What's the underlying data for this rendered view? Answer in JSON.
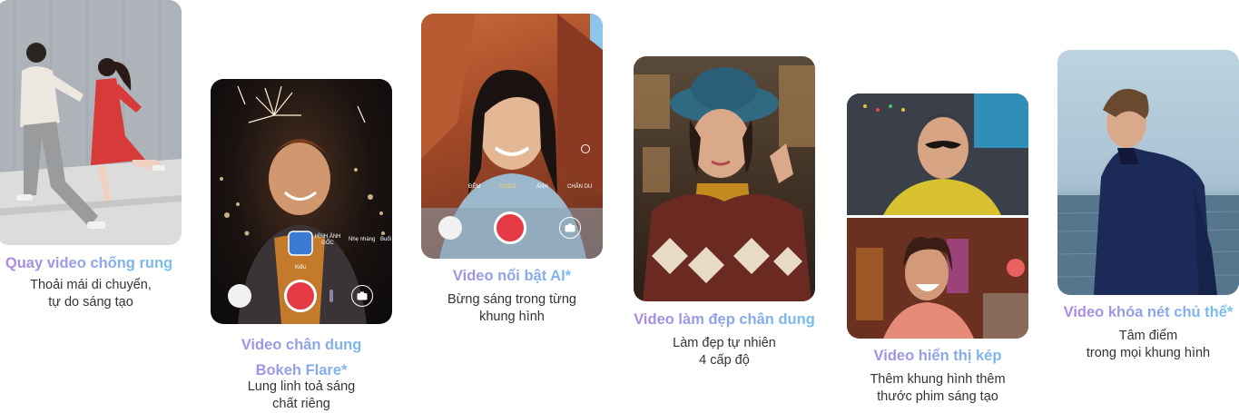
{
  "features": [
    {
      "title": "Quay video chống rung",
      "desc_line1": "Thoải mái di chuyển,",
      "desc_line2": "tự do sáng tạo"
    },
    {
      "title_line1": "Video chân dung",
      "title_line2": "Bokeh Flare*",
      "desc_line1": "Lung linh toả sáng",
      "desc_line2": "chất riêng",
      "camera_ui": {
        "original_label": "HÌNH ẢNH GỐC",
        "soft_label": "Nhẹ nhàng",
        "warm_label": "Buổi",
        "style_label": "Kiểu"
      }
    },
    {
      "title": "Video nổi bật AI*",
      "desc_line1": "Bừng sáng trong từng",
      "desc_line2": "khung hình",
      "camera_ui": {
        "modes": [
          "ĐÊM",
          "VIDEO",
          "ẢNH",
          "CHÂN DU"
        ],
        "active_mode": "VIDEO"
      }
    },
    {
      "title": "Video làm đẹp chân dung",
      "desc_line1": "Làm đẹp tự nhiên",
      "desc_line2": "4 cấp độ"
    },
    {
      "title": "Video hiển thị kép",
      "desc_line1": "Thêm khung hình thêm",
      "desc_line2": "thước phim sáng tạo"
    },
    {
      "title": "Video khóa nét chủ thể*",
      "desc_line1": "Tâm điểm",
      "desc_line2": "trong mọi khung hình"
    }
  ],
  "colors": {
    "title_gradient_start": "#b184e4",
    "title_gradient_end": "#6fc4ef",
    "shutter": "#e63946",
    "desc_text": "#333333"
  }
}
